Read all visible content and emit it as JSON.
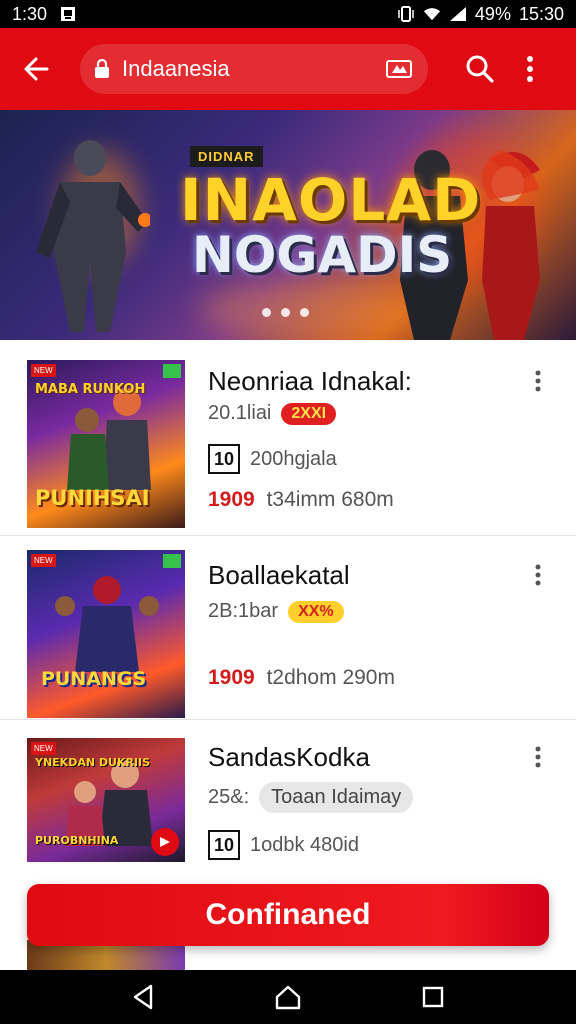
{
  "status_bar": {
    "time_left": "1:30",
    "battery": "49%",
    "time_right": "15:30"
  },
  "app_bar": {
    "url": "Indaanesia"
  },
  "hero": {
    "subtitle": "DIDNAR",
    "title_line1": "INAOLAD",
    "title_line2": "NOGADIS",
    "slide_count": 3
  },
  "items": [
    {
      "title": "Neonriaa Idnakal:",
      "thumb_title": "PUNIHSAI",
      "thumb_top": "MABA RUNKOH",
      "meta1_text": "20.1liai",
      "meta1_tag": "2XXI",
      "meta2_age": "10",
      "meta2_text": "200hgjala",
      "price_num": "1909",
      "price_text": "t34imm 680m"
    },
    {
      "title": "Boallaekatal",
      "thumb_title": "PUNANGS",
      "thumb_top": "",
      "meta1_text": "2B:1bar",
      "meta1_tag": "XX%",
      "price_num": "1909",
      "price_text": "t2dhom 290m"
    },
    {
      "title": "SandasKodka",
      "thumb_title": "PUROBNHINA",
      "thumb_top": "YNEKDAN DUKRIIS",
      "meta1_text": "25&:",
      "meta1_tag": "Toaan Idaimay",
      "meta2_age": "10",
      "meta2_text": "1odbk 480id"
    }
  ],
  "cta": {
    "label": "Confinaned"
  },
  "colors": {
    "brand_red": "#e00a12",
    "price_red": "#d21b1b",
    "tag_yellow": "#ffcf2b"
  },
  "icons": {
    "back": "back-arrow-icon",
    "lock": "lock-icon",
    "search": "search-icon",
    "more": "more-vert-icon",
    "nav_back": "nav-back-icon",
    "nav_home": "nav-home-icon",
    "nav_recents": "nav-recents-icon"
  }
}
